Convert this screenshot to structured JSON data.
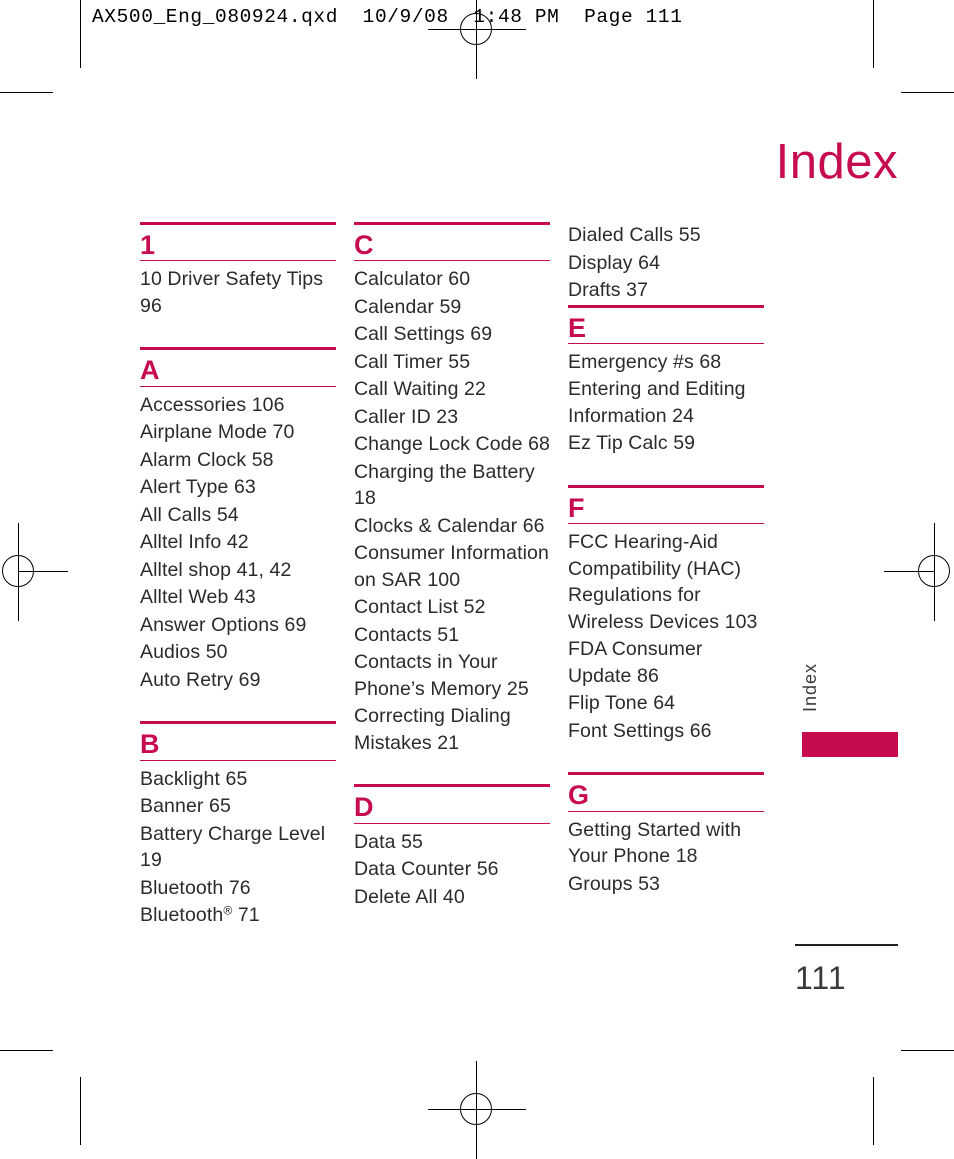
{
  "proof_header": "AX500_Eng_080924.qxd  10/9/08  1:48 PM  Page 111",
  "page_title": "Index",
  "side_tab_label": "Index",
  "folio": "111",
  "accent_color": "#c60c4e",
  "columns": [
    {
      "name": "column-1",
      "sections": [
        {
          "letter": "1",
          "entries": [
            "10 Driver Safety Tips 96"
          ]
        },
        {
          "letter": "A",
          "entries": [
            "Accessories 106",
            "Airplane Mode 70",
            "Alarm Clock 58",
            "Alert Type 63",
            "All Calls 54",
            "Alltel Info 42",
            "Alltel shop 41, 42",
            "Alltel Web 43",
            "Answer Options 69",
            "Audios 50",
            "Auto Retry 69"
          ]
        },
        {
          "letter": "B",
          "entries": [
            "Backlight 65",
            "Banner 65",
            "Battery Charge Level 19",
            "Bluetooth 76",
            "Bluetooth® 71"
          ]
        }
      ]
    },
    {
      "name": "column-2",
      "sections": [
        {
          "letter": "C",
          "entries": [
            "Calculator 60",
            "Calendar 59",
            "Call Settings 69",
            "Call Timer 55",
            "Call Waiting 22",
            "Caller ID 23",
            "Change Lock Code 68",
            "Charging the Battery 18",
            "Clocks & Calendar 66",
            "Consumer Information on SAR 100",
            "Contact List 52",
            "Contacts 51",
            "Contacts in Your Phone’s Memory 25",
            "Correcting Dialing Mistakes 21"
          ]
        },
        {
          "letter": "D",
          "entries": [
            "Data 55",
            "Data Counter 56",
            "Delete All 40"
          ]
        }
      ]
    },
    {
      "name": "column-3",
      "continued_entries": [
        "Dialed Calls 55",
        "Display 64",
        "Drafts 37"
      ],
      "sections": [
        {
          "letter": "E",
          "entries": [
            "Emergency #s 68",
            "Entering and Editing Information 24",
            "Ez Tip Calc 59"
          ]
        },
        {
          "letter": "F",
          "entries": [
            "FCC Hearing-Aid Compatibility (HAC) Regulations for Wireless Devices 103",
            "FDA Consumer Update 86",
            "Flip Tone 64",
            "Font Settings 66"
          ]
        },
        {
          "letter": "G",
          "entries": [
            "Getting Started with Your Phone 18",
            "Groups 53"
          ]
        }
      ]
    }
  ]
}
